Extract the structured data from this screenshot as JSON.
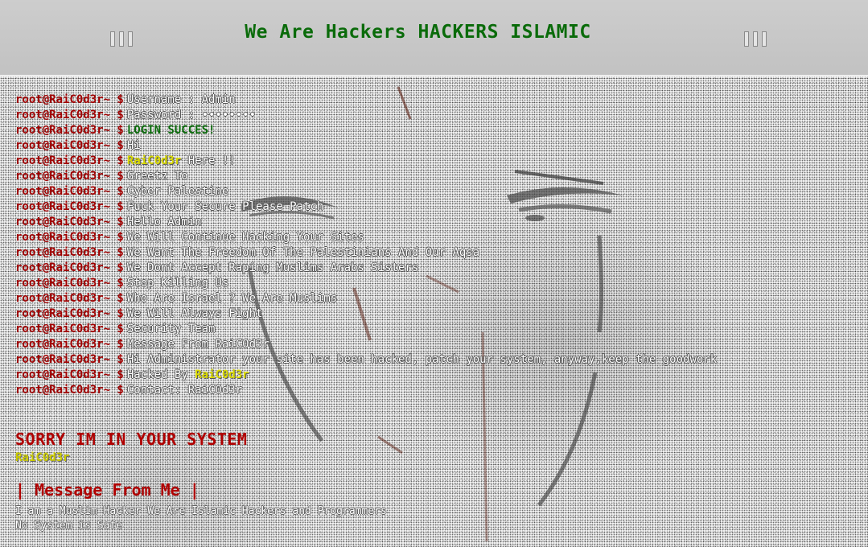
{
  "header": {
    "title": "We Are Hackers HACKERS ISLAMIC",
    "left_icon": "window-controls-icon",
    "right_icon": "window-controls-icon"
  },
  "console": {
    "prompt": "root@RaiC0d3r~ $",
    "lines": [
      {
        "cmd": "Username : Admin"
      },
      {
        "cmd": "Password : ••••••••"
      },
      {
        "cmd": "LOGIN SUCCES!"
      },
      {
        "cmd": "Hi"
      },
      {
        "cmd_pre": "",
        "highlight": "RaiC0d3r",
        "cmd_post": " Here !!"
      },
      {
        "cmd": "Greetz To"
      },
      {
        "cmd": "Cyber Palestine"
      },
      {
        "cmd": "Fuck Your Secure Please Patch"
      },
      {
        "cmd": "Hello Admin"
      },
      {
        "cmd": "We Will Continue Hacking Your Sites"
      },
      {
        "cmd": "We Want The Freedom Of The Palestinians And Our Aqsa"
      },
      {
        "cmd": "We Dont Accept Raping Muslims Arabs Sisters"
      },
      {
        "cmd": "Stop Killing Us"
      },
      {
        "cmd": "Who Are Israel ? We Are Muslims"
      },
      {
        "cmd": "We Will Always Fight"
      },
      {
        "cmd": "Security Team"
      },
      {
        "cmd": "Message From RaiC0d3r"
      },
      {
        "cmd": "Hi Administrator your site has been hacked, patch your system, anyway,keep the goodwork"
      },
      {
        "cmd_pre": "Hacked By ",
        "highlight": "RaiC0d3r",
        "cmd_post": ""
      },
      {
        "cmd": "Contact: RaiC0d3r"
      }
    ]
  },
  "footer": {
    "sorry": "SORRY IM IN YOUR SYSTEM",
    "alias": "RaiC0d3r",
    "message_heading": "| Message From Me |",
    "message_line1": "I am a Muslim Hacker We Are Islamic Hackers and Programmers",
    "message_line2": "No System is Safe"
  },
  "colors": {
    "title_green": "#0a6b0a",
    "prompt_red": "#a00000",
    "highlight_yellow": "#d9d900"
  }
}
